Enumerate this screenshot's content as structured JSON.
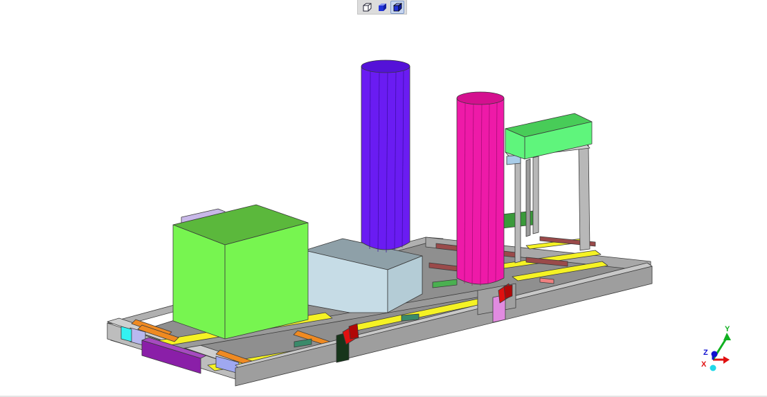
{
  "toolbar": {
    "buttons": [
      {
        "icon": "wireframe-cube-icon",
        "active": false
      },
      {
        "icon": "shaded-cube-icon",
        "active": false
      },
      {
        "icon": "shaded-edges-cube-icon",
        "active": true
      }
    ]
  },
  "axes": {
    "y_label": "Y",
    "z_label": "Z",
    "x_label": "X",
    "colors": {
      "x": "#e01010",
      "y": "#10b020",
      "z": "#1010d0"
    }
  },
  "model_colors": {
    "frame": "#a9a9a9",
    "green_box": "#77f550",
    "grey_box": "#c6dce6",
    "blue_cylinder": "#6a1cf2",
    "magenta_cylinder": "#ee1aa8",
    "gantry_box": "#5ff57c",
    "rails": "#f5f224",
    "purple_block": "#8a1fa8",
    "red_parts": "#e01010"
  }
}
